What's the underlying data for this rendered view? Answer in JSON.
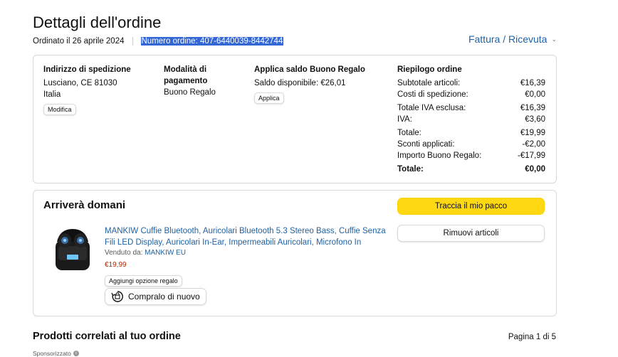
{
  "page": {
    "title": "Dettagli dell'ordine",
    "order_date": "Ordinato il 26 aprile 2024",
    "order_number": "Numero ordine: 407-6440039-8442744",
    "invoice_link": "Fattura / Ricevuta"
  },
  "shipping": {
    "heading": "Indirizzo di spedizione",
    "line1": "Lusciano, CE 81030",
    "line2": "Italia",
    "edit_button": "Modifica"
  },
  "payment": {
    "heading_line1": "Modalità di",
    "heading_line2": "pagamento",
    "method": "Buono Regalo"
  },
  "giftcard": {
    "heading": "Applica saldo Buono Regalo",
    "balance": "Saldo disponibile: €26,01",
    "apply_button": "Applica"
  },
  "summary": {
    "heading": "Riepilogo ordine",
    "rows": [
      {
        "label": "Subtotale articoli:",
        "value": "€16,39"
      },
      {
        "label": "Costi di spedizione:",
        "value": "€0,00"
      },
      {
        "label": "Totale IVA esclusa:",
        "value": "€16,39"
      },
      {
        "label": "IVA:",
        "value": "€3,60"
      },
      {
        "label": "Totale:",
        "value": "€19,99"
      },
      {
        "label": "Sconti applicati:",
        "value": "-€2,00"
      },
      {
        "label": "Importo Buono Regalo:",
        "value": "-€17,99"
      },
      {
        "label": "Totale:",
        "value": "€0,00"
      }
    ]
  },
  "shipment": {
    "status": "Arriverà domani",
    "track_button": "Traccia il mio pacco",
    "remove_button": "Rimuovi articoli",
    "product_title": "MANKIW Cuffie Bluetooth, Auricolari Bluetooth 5.3 Stereo Bass, Cuffie Senza Fili LED Display, Auricolari In-Ear, Impermeabili Auricolari, Microfono In",
    "sold_by_label": "Venduto da:",
    "seller": "MANKIW EU",
    "price": "€19,99",
    "gift_option": "Aggiungi opzione regalo",
    "buy_again": "Compralo di nuovo"
  },
  "related": {
    "heading": "Prodotti correlati al tuo ordine",
    "pagination": "Pagina 1 di 5",
    "sponsored": "Sponsorizzato"
  },
  "colors": {
    "link": "#2162a1",
    "price": "#b12704",
    "primary_button": "#ffd814",
    "highlight": "#3367d6"
  }
}
